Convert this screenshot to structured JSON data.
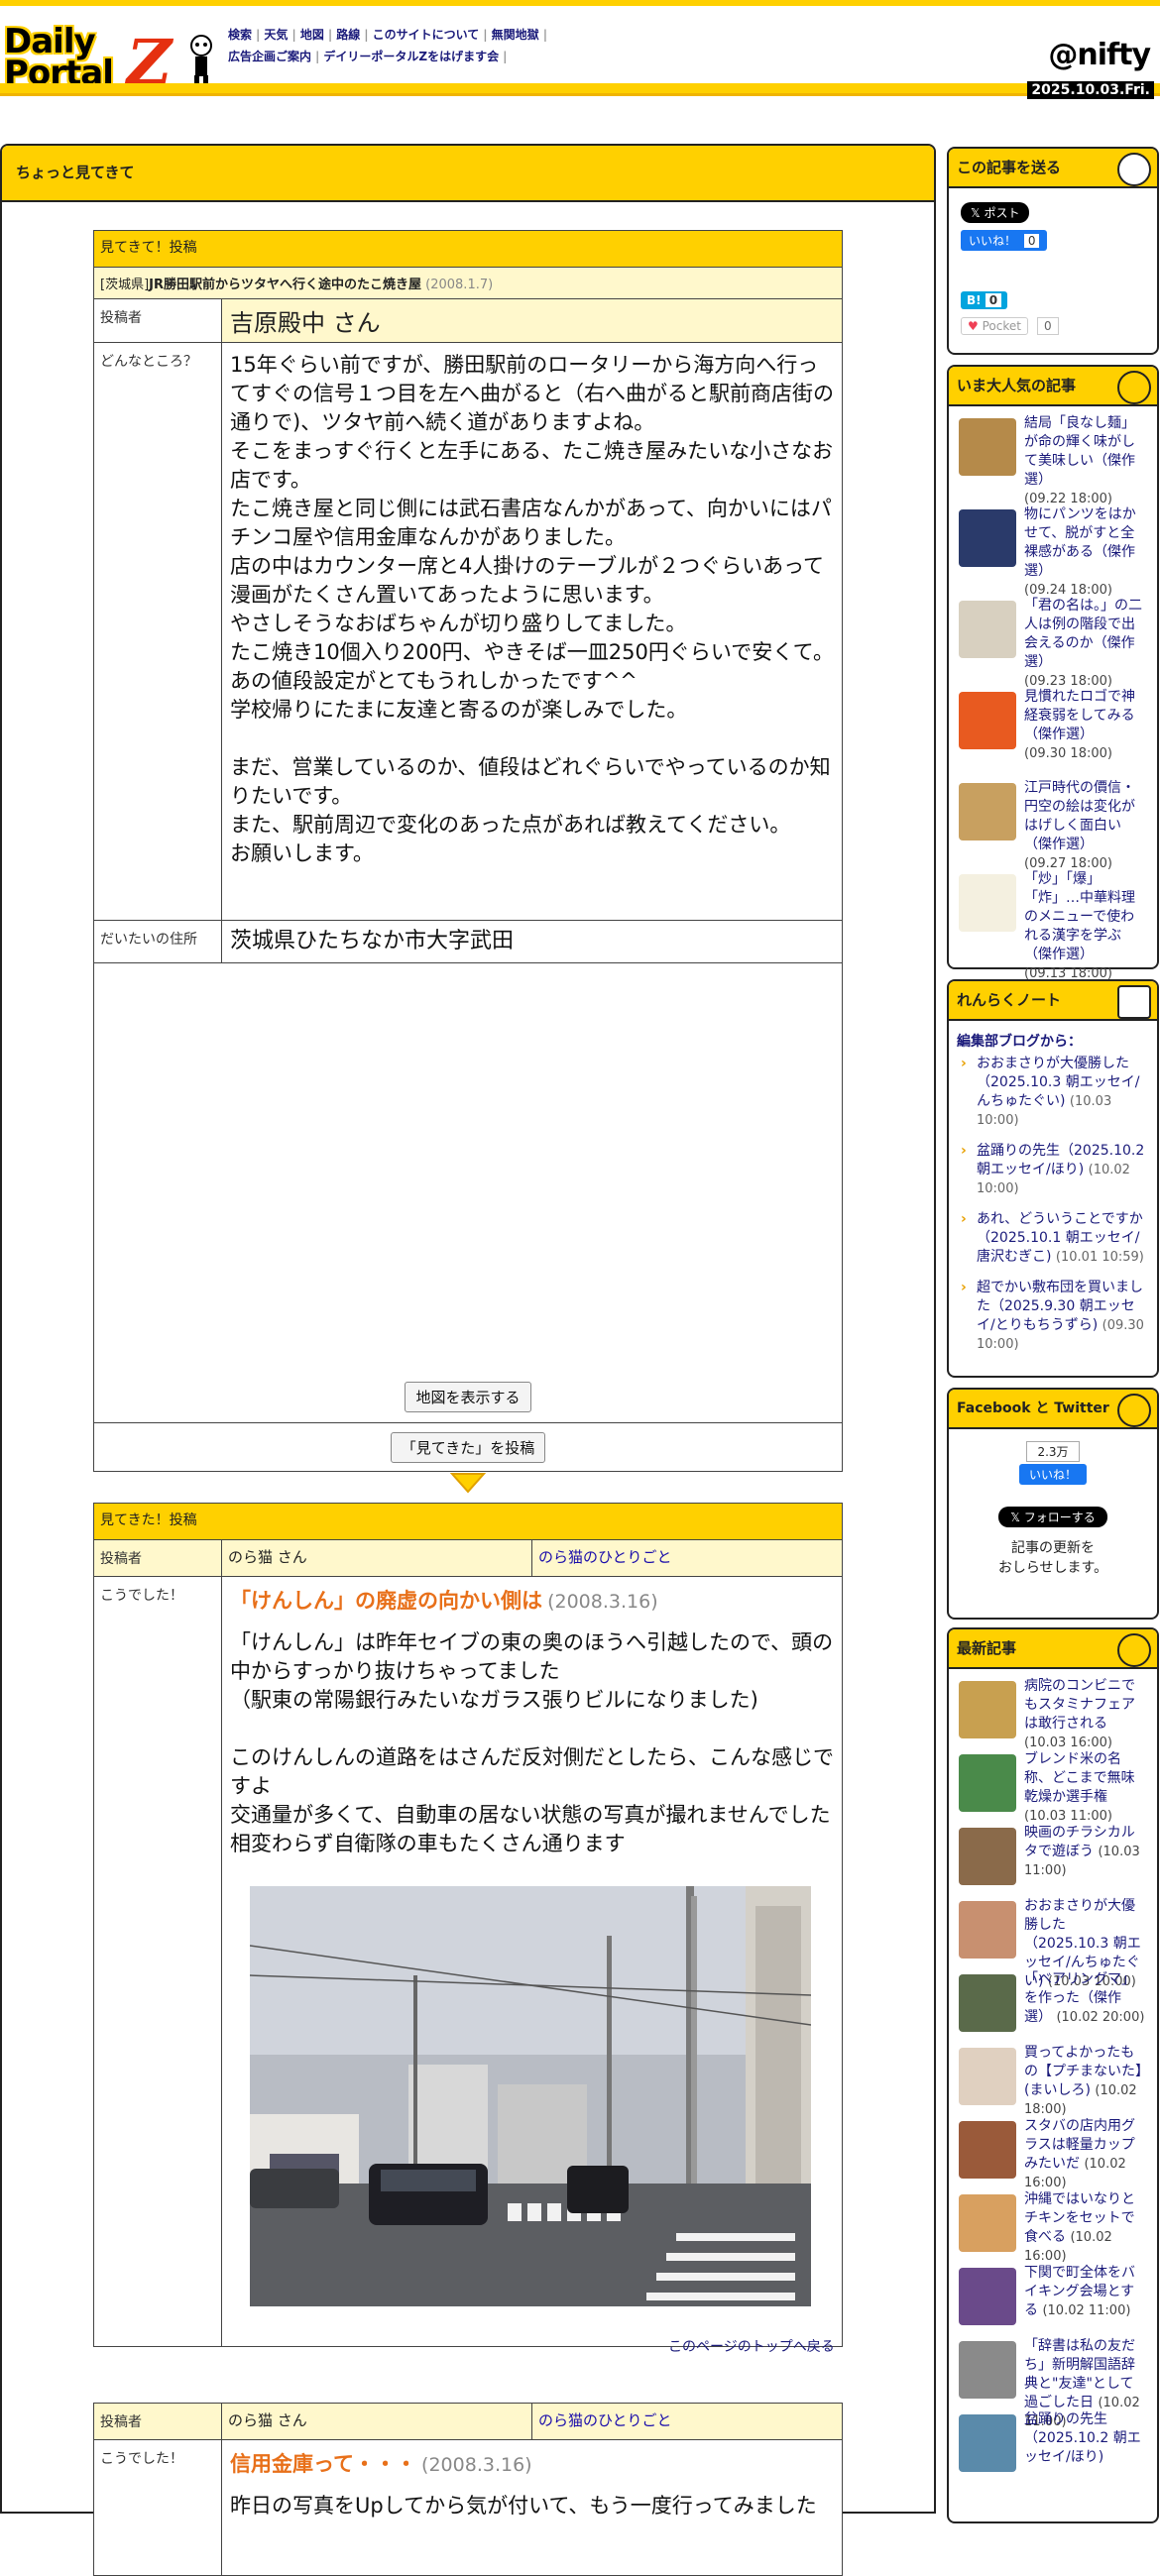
{
  "header": {
    "logo_line1": "Daily",
    "logo_line2": "Portal",
    "logo_z": "Z",
    "nav_row1": [
      "検索",
      "天気",
      "地図",
      "路線",
      "このサイトについて",
      "無関地獄"
    ],
    "nav_row2": [
      "広告企画ご案内",
      "デイリーポータルZをはげます会"
    ],
    "brand": "@nifty",
    "date": "2025.10.03.Fri."
  },
  "main": {
    "section_title": "ちょっと見てきて",
    "request": {
      "header": "見てきて！投稿",
      "pref": "[茨城県]",
      "title": "JR勝田駅前からツタヤへ行く途中のたこ焼き屋",
      "date": "(2008.1.7)",
      "poster_label": "投稿者",
      "poster_name": "吉原殿中 さん",
      "where_label": "どんなところ？",
      "body_lines": [
        "15年ぐらい前ですが、勝田駅前のロータリーから海方向へ行ってすぐの信号１つ目を左へ曲がると（右へ曲がると駅前商店街の通りで)、ツタヤ前へ続く道がありますよね。",
        "そこをまっすぐ行くと左手にある、たこ焼き屋みたいな小さなお店です。",
        "たこ焼き屋と同じ側には武石書店なんかがあって、向かいにはパチンコ屋や信用金庫なんかがありました。",
        "店の中はカウンター席と4人掛けのテーブルが２つぐらいあって漫画がたくさん置いてあったように思います。",
        "やさしそうなおばちゃんが切り盛りしてました。",
        "たこ焼き10個入り200円、やきそば一皿250円ぐらいで安くて。",
        "あの値段設定がとてもうれしかったです^^",
        "学校帰りにたまに友達と寄るのが楽しみでした。",
        "",
        "まだ、営業しているのか、値段はどれぐらいでやっているのか知りたいです。",
        "また、駅前周辺で変化のあった点があれば教えてください。",
        "お願いします。"
      ],
      "address_label": "だいたいの住所",
      "address": "茨城県ひたちなか市大字武田",
      "map_button": "地図を表示する",
      "post_button": "「見てきた」を投稿"
    },
    "report1": {
      "header": "見てきた！投稿",
      "poster_label": "投稿者",
      "poster_name": "のら猫 さん",
      "blog_link": "のら猫のひとりごと",
      "result_label": "こうでした！",
      "title": "「けんしん」の廃虚の向かい側は",
      "date": "(2008.3.16)",
      "body_lines": [
        "「けんしん」は昨年セイブの東の奥のほうへ引越したので、頭の中からすっかり抜けちゃってました",
        "（駅東の常陽銀行みたいなガラス張りビルになりました)",
        "",
        "このけんしんの道路をはさんだ反対側だとしたら、こんな感じですよ",
        "交通量が多くて、自動車の居ない状態の写真が撮れませんでした",
        "相変わらず自衛隊の車もたくさん通ります"
      ],
      "back_to_top": "このページのトップへ戻る"
    },
    "report2": {
      "poster_label": "投稿者",
      "poster_name": "のら猫 さん",
      "blog_link": "のら猫のひとりごと",
      "result_label": "こうでした！",
      "title": "信用金庫って・・・",
      "date": "(2008.3.16)",
      "body_first": "昨日の写真をUpしてから気が付いて、もう一度行ってみました"
    }
  },
  "sidebar": {
    "share": {
      "title": "この記事を送る",
      "post_label": "𝕏 ポスト",
      "like_label": "いいね！",
      "like_count": "0",
      "hatena_count": "0",
      "pocket_label": "Pocket",
      "pocket_count": "0"
    },
    "popular": {
      "title": "いま大人気の記事",
      "items": [
        {
          "text": "結局「良なし麺」が命の輝く味がして美味しい（傑作選）",
          "date": "(09.22 18:00)",
          "color": "#b58a4a"
        },
        {
          "text": "物にパンツをはかせて、脱がすと全裸感がある（傑作選）",
          "date": "(09.24 18:00)",
          "color": "#2a3a6a"
        },
        {
          "text": "「君の名は。」の二人は例の階段で出会えるのか（傑作選）",
          "date": "(09.23 18:00)",
          "color": "#d8d0c0"
        },
        {
          "text": "見慣れたロゴで神経衰弱をしてみる（傑作選）",
          "date": "(09.30 18:00)",
          "color": "#e85a20"
        },
        {
          "text": "江戸時代の價信・円空の絵は変化がはげしく面白い（傑作選）",
          "date": "(09.27 18:00)",
          "color": "#c8a060"
        },
        {
          "text": "「炒」「爆」「炸」…中華料理のメニューで使われる漢字を学ぶ（傑作選）",
          "date": "(09.13 18:00)",
          "color": "#f4f0e0"
        }
      ]
    },
    "notes": {
      "title": "れんらくノート",
      "intro": "編集部ブログから：",
      "items": [
        {
          "text": "おおまさりが大優勝した（2025.10.3 朝エッセイ/んちゅたぐい)",
          "date": "(10.03 10:00)"
        },
        {
          "text": "盆踊りの先生（2025.10.2 朝エッセイ/ほり)",
          "date": "(10.02 10:00)"
        },
        {
          "text": "あれ、どういうことですか（2025.10.1 朝エッセイ/唐沢むぎこ)",
          "date": "(10.01 10:59)"
        },
        {
          "text": "超でかい敷布団を買いました（2025.9.30 朝エッセイ/とりもちうずら)",
          "date": "(09.30 10:00)"
        }
      ]
    },
    "social": {
      "title": "Facebook と Twitter",
      "count": "2.3万",
      "like_label": "いいね！",
      "follow_label": "𝕏 フォローする",
      "note_line1": "記事の更新を",
      "note_line2": "おしらせします。"
    },
    "latest": {
      "title": "最新記事",
      "items": [
        {
          "text": "病院のコンビニでもスタミナフェアは敢行される",
          "date": "(10.03 16:00)",
          "color": "#c8a050"
        },
        {
          "text": "ブレンド米の名称、どこまで無味乾燥か選手権",
          "date": "(10.03 11:00)",
          "color": "#4a8a4a"
        },
        {
          "text": "映画のチラシカルタで遊ぼう",
          "date": "(10.03 11:00)",
          "color": "#8a6a4a"
        },
        {
          "text": "おおまさりが大優勝した（2025.10.3 朝エッセイ/んちゅたぐい)",
          "date": "(10.03 10:00)",
          "color": "#c89070"
        },
        {
          "text": "「ベアリングマ」を作った（傑作選）",
          "date": "(10.02 20:00)",
          "color": "#5a6a4a"
        },
        {
          "text": "買ってよかったもの【プチまないた】(まいしろ)",
          "date": "(10.02 18:00)",
          "color": "#e0d0c0"
        },
        {
          "text": "スタバの店内用グラスは軽量カップみたいだ",
          "date": "(10.02 16:00)",
          "color": "#9a5a3a"
        },
        {
          "text": "沖縄ではいなりとチキンをセットで食べる",
          "date": "(10.02 16:00)",
          "color": "#d8a060"
        },
        {
          "text": "下関で町全体をバイキング会場とする",
          "date": "(10.02 11:00)",
          "color": "#6a4a8a"
        },
        {
          "text": "「辞書は私の友だち」新明解国語辞典と\"友達\"として過ごした日",
          "date": "(10.02 11:00)",
          "color": "#8a8a8a"
        },
        {
          "text": "盆踊りの先生（2025.10.2 朝エッセイ/ほり)",
          "date": "",
          "color": "#5a8aaa"
        }
      ]
    }
  }
}
